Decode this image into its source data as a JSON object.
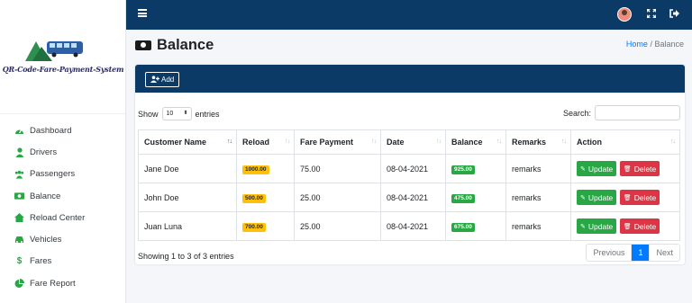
{
  "app": {
    "logo_text": "QR-Code-Fare-Payment-System"
  },
  "sidebar": {
    "items": [
      {
        "label": "Dashboard",
        "icon": "tachometer-icon"
      },
      {
        "label": "Drivers",
        "icon": "user-icon"
      },
      {
        "label": "Passengers",
        "icon": "users-icon"
      },
      {
        "label": "Balance",
        "icon": "money-icon"
      },
      {
        "label": "Reload Center",
        "icon": "home-icon"
      },
      {
        "label": "Vehicles",
        "icon": "car-icon"
      },
      {
        "label": "Fares",
        "icon": "dollar-icon"
      },
      {
        "label": "Fare Report",
        "icon": "pie-chart-icon"
      }
    ]
  },
  "header": {
    "title": "Balance"
  },
  "breadcrumb": {
    "home": "Home",
    "separator": "/",
    "current": "Balance"
  },
  "toolbar": {
    "add_label": "Add"
  },
  "table_controls": {
    "show_label": "Show",
    "entries_value": "10",
    "entries_label": "entries",
    "search_label": "Search:"
  },
  "table": {
    "columns": [
      "Customer Name",
      "Reload",
      "Fare Payment",
      "Date",
      "Balance",
      "Remarks",
      "Action"
    ],
    "rows": [
      {
        "name": "Jane Doe",
        "reload": "1000.00",
        "fare": "75.00",
        "date": "08-04-2021",
        "balance": "925.00",
        "remarks": "remarks"
      },
      {
        "name": "John Doe",
        "reload": "500.00",
        "fare": "25.00",
        "date": "08-04-2021",
        "balance": "475.00",
        "remarks": "remarks"
      },
      {
        "name": "Juan Luna",
        "reload": "700.00",
        "fare": "25.00",
        "date": "08-04-2021",
        "balance": "675.00",
        "remarks": "remarks"
      }
    ],
    "update_label": "Update",
    "delete_label": "Delete"
  },
  "footer": {
    "info": "Showing 1 to 3 of 3 entries",
    "previous": "Previous",
    "page": "1",
    "next": "Next"
  },
  "colors": {
    "navbar": "#0b3a66",
    "accent": "#007bff",
    "success": "#28a745",
    "danger": "#dc3545",
    "warning": "#ffc107"
  }
}
